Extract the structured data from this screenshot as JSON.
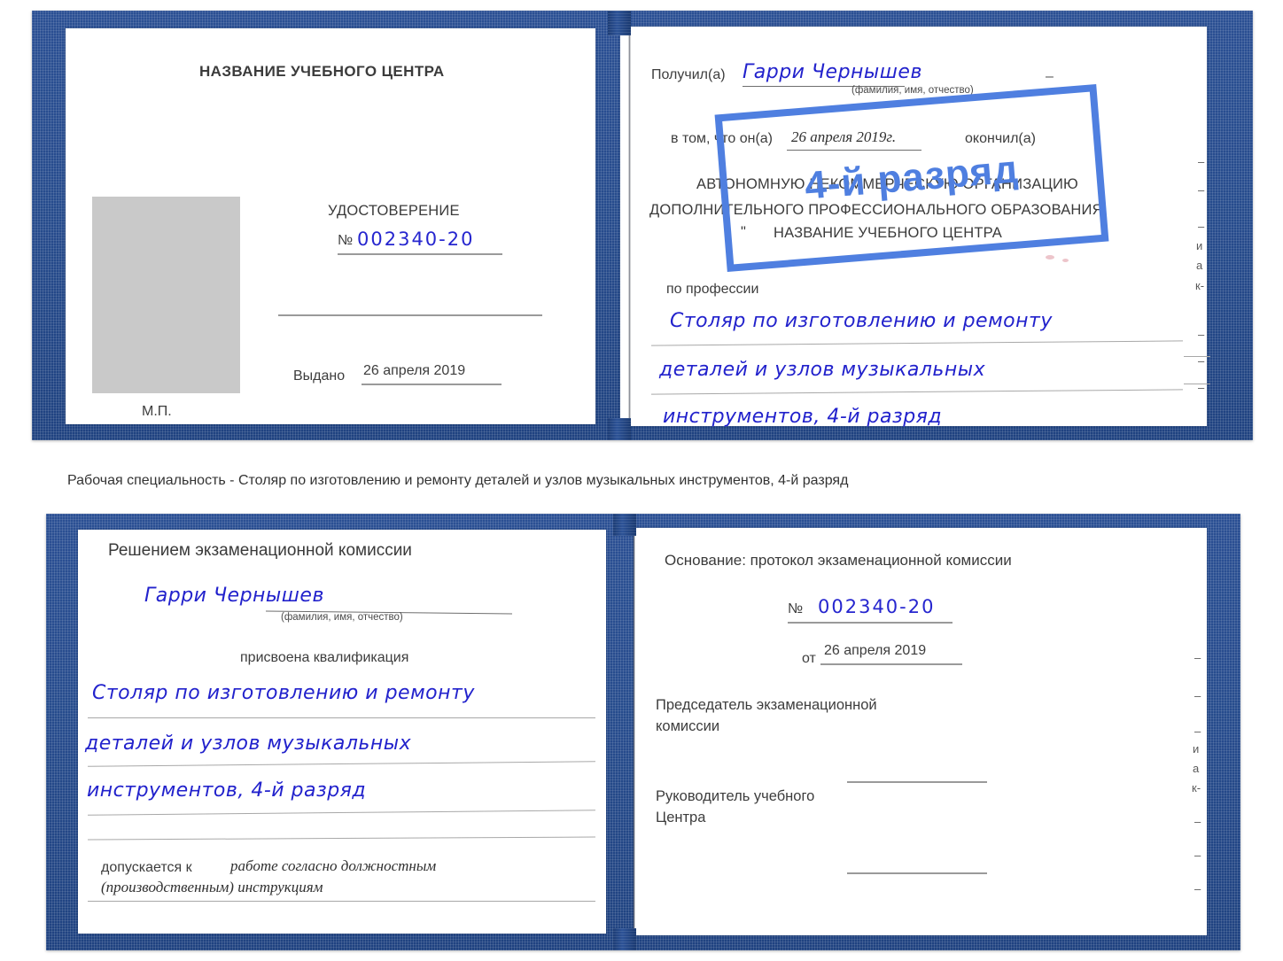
{
  "document": {
    "type": "Russian vocational qualification certificate (udostoverenie), two spreads photographed",
    "cover_color": "#27509a",
    "pen_color": "#2222cc",
    "stamp_color": "#4f7fe0",
    "photo_placeholder_color": "#c9c9c9"
  },
  "caption": {
    "text": "Рабочая специальность - Столяр по изготовлению и ремонту деталей и узлов музыкальных инструментов, 4-й разряд"
  },
  "spread_top": {
    "left_page": {
      "center_title": "НАЗВАНИЕ УЧЕБНОГО ЦЕНТРА",
      "document_word": "УДОСТОВЕРЕНИЕ",
      "number_label": "№",
      "number_value": "002340-20",
      "issued_label": "Выдано",
      "issued_value": "26 апреля 2019",
      "seal_label": "М.П."
    },
    "right_page": {
      "received_label": "Получил(а)",
      "received_value": "Гарри Чернышев",
      "fio_hint": "(фамилия, имя, отчество)",
      "in_that_label": "в том, что он(а)",
      "date_value": "26 апреля 2019г.",
      "finished_label": "окончил(а)",
      "org_line1": "АВТОНОМНУЮ НЕКОММЕРЧЕСКУЮ ОРГАНИЗАЦИЮ",
      "org_line2": "ДОПОЛНИТЕЛЬНОГО ПРОФЕССИОНАЛЬНОГО ОБРАЗОВАНИЯ",
      "org_quote_open": "\"",
      "org_name": "НАЗВАНИЕ УЧЕБНОГО ЦЕНТРА",
      "org_quote_close": "\"",
      "profession_label": "по профессии",
      "profession_line1": "Столяр по изготовлению и ремонту",
      "profession_line2": "деталей и узлов музыкальных",
      "profession_line3": "инструментов, 4-й разряд",
      "stamp_text": "4-й разряд"
    }
  },
  "spread_bottom": {
    "left_page": {
      "heading": "Решением экзаменационной комиссии",
      "name_value": "Гарри Чернышев",
      "fio_hint": "(фамилия, имя, отчество)",
      "assigned_label": "присвоена квалификация",
      "qualification_line1": "Столяр по изготовлению и ремонту",
      "qualification_line2": "деталей и узлов музыкальных",
      "qualification_line3": "инструментов, 4-й разряд",
      "admitted_label": "допускается к",
      "admitted_value_line1": "работе согласно должностным",
      "admitted_value_line2": "(производственным) инструкциям"
    },
    "right_page": {
      "basis_label": "Основание: протокол экзаменационной комиссии",
      "number_label": "№",
      "number_value": "002340-20",
      "from_label": "от",
      "from_value": "26 апреля 2019",
      "chairman_line1": "Председатель экзаменационной",
      "chairman_line2": "комиссии",
      "head_line1": "Руководитель учебного",
      "head_line2": "Центра"
    }
  },
  "page_edge_marks": {
    "top": [
      "–",
      "–",
      "–",
      "и",
      "а",
      "к-",
      "–",
      "–"
    ],
    "bottom": [
      "–",
      "–",
      "и",
      "а",
      "к-",
      "–",
      "–",
      "–"
    ]
  }
}
